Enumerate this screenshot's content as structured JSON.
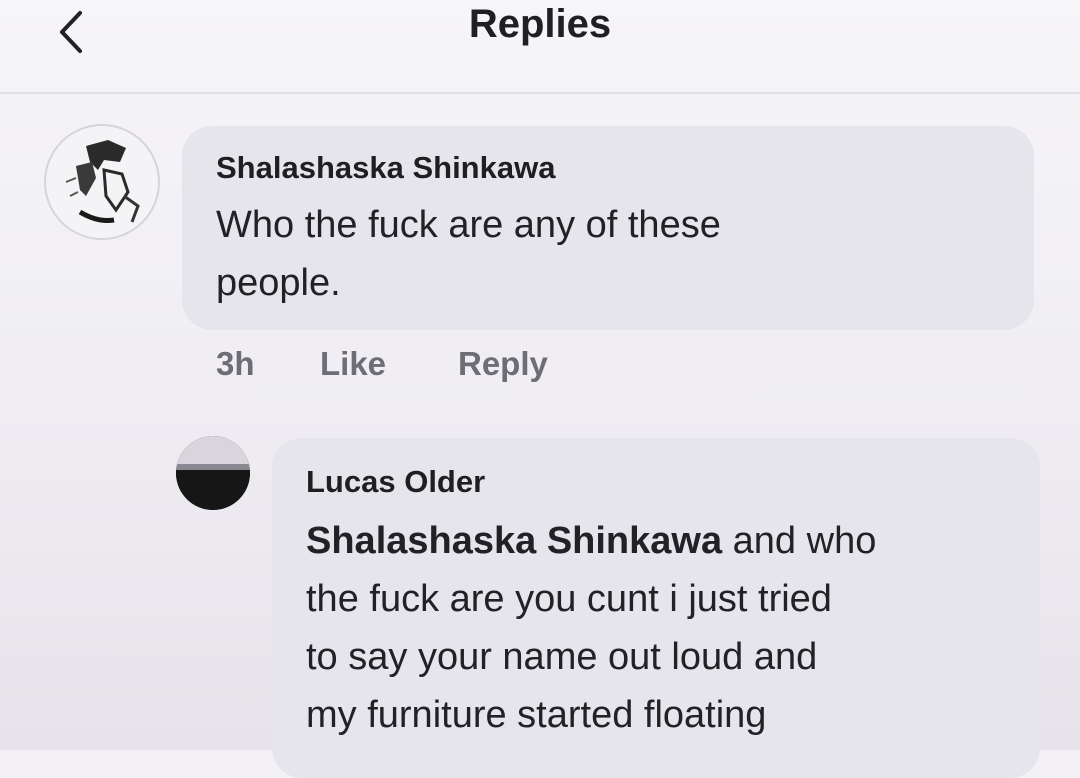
{
  "header": {
    "title": "Replies",
    "back_icon": "chevron-left-icon"
  },
  "comments": [
    {
      "author": "Shalashaska Shinkawa",
      "text_lines": [
        "Who the fuck are any of these",
        "people."
      ],
      "time": "3h",
      "like_label": "Like",
      "reply_label": "Reply"
    },
    {
      "author": "Lucas Older",
      "mention": "Shalashaska Shinkawa",
      "text_line1_rest": " and who",
      "text_lines": [
        "the fuck are you cunt i just tried",
        "to say your name out loud and",
        "my furniture started floating"
      ]
    }
  ]
}
